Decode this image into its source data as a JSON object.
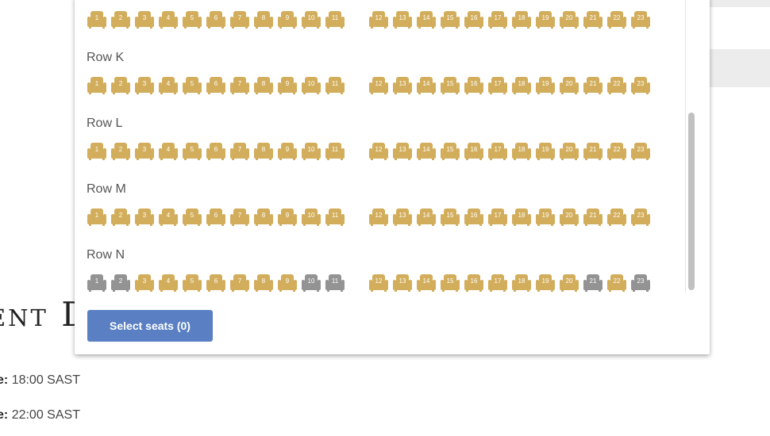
{
  "background": {
    "heading": "ent D",
    "start_time_label": "e:",
    "start_time_value": "18:00 SAST",
    "end_time_label": "e:",
    "end_time_value": "22:00 SAST"
  },
  "colors": {
    "available": "#d2ad5b",
    "unavailable": "#939393",
    "button": "#5a80c3"
  },
  "seating": {
    "rows": [
      {
        "label": "",
        "label_hidden": true,
        "seats": [
          {
            "n": "1",
            "s": "a"
          },
          {
            "n": "2",
            "s": "a"
          },
          {
            "n": "3",
            "s": "a"
          },
          {
            "n": "4",
            "s": "a"
          },
          {
            "n": "5",
            "s": "a"
          },
          {
            "n": "6",
            "s": "a"
          },
          {
            "n": "7",
            "s": "a"
          },
          {
            "n": "8",
            "s": "a"
          },
          {
            "n": "9",
            "s": "a"
          },
          {
            "n": "10",
            "s": "a"
          },
          {
            "n": "11",
            "s": "a"
          },
          {
            "n": "12",
            "s": "a"
          },
          {
            "n": "13",
            "s": "a"
          },
          {
            "n": "14",
            "s": "a"
          },
          {
            "n": "15",
            "s": "a"
          },
          {
            "n": "16",
            "s": "a"
          },
          {
            "n": "17",
            "s": "a"
          },
          {
            "n": "18",
            "s": "a"
          },
          {
            "n": "19",
            "s": "a"
          },
          {
            "n": "20",
            "s": "a"
          },
          {
            "n": "21",
            "s": "a"
          },
          {
            "n": "22",
            "s": "a"
          },
          {
            "n": "23",
            "s": "a"
          }
        ]
      },
      {
        "label": "Row K",
        "seats": [
          {
            "n": "1",
            "s": "a"
          },
          {
            "n": "2",
            "s": "a"
          },
          {
            "n": "3",
            "s": "a"
          },
          {
            "n": "4",
            "s": "a"
          },
          {
            "n": "5",
            "s": "a"
          },
          {
            "n": "6",
            "s": "a"
          },
          {
            "n": "7",
            "s": "a"
          },
          {
            "n": "8",
            "s": "a"
          },
          {
            "n": "9",
            "s": "a"
          },
          {
            "n": "10",
            "s": "a"
          },
          {
            "n": "11",
            "s": "a"
          },
          {
            "n": "12",
            "s": "a"
          },
          {
            "n": "13",
            "s": "a"
          },
          {
            "n": "14",
            "s": "a"
          },
          {
            "n": "15",
            "s": "a"
          },
          {
            "n": "16",
            "s": "a"
          },
          {
            "n": "17",
            "s": "a"
          },
          {
            "n": "18",
            "s": "a"
          },
          {
            "n": "19",
            "s": "a"
          },
          {
            "n": "20",
            "s": "a"
          },
          {
            "n": "21",
            "s": "a"
          },
          {
            "n": "22",
            "s": "a"
          },
          {
            "n": "23",
            "s": "a"
          }
        ]
      },
      {
        "label": "Row L",
        "seats": [
          {
            "n": "1",
            "s": "a"
          },
          {
            "n": "2",
            "s": "a"
          },
          {
            "n": "3",
            "s": "a"
          },
          {
            "n": "4",
            "s": "a"
          },
          {
            "n": "5",
            "s": "a"
          },
          {
            "n": "6",
            "s": "a"
          },
          {
            "n": "7",
            "s": "a"
          },
          {
            "n": "8",
            "s": "a"
          },
          {
            "n": "9",
            "s": "a"
          },
          {
            "n": "10",
            "s": "a"
          },
          {
            "n": "11",
            "s": "a"
          },
          {
            "n": "12",
            "s": "a"
          },
          {
            "n": "13",
            "s": "a"
          },
          {
            "n": "14",
            "s": "a"
          },
          {
            "n": "15",
            "s": "a"
          },
          {
            "n": "16",
            "s": "a"
          },
          {
            "n": "17",
            "s": "a"
          },
          {
            "n": "18",
            "s": "a"
          },
          {
            "n": "19",
            "s": "a"
          },
          {
            "n": "20",
            "s": "a"
          },
          {
            "n": "21",
            "s": "a"
          },
          {
            "n": "22",
            "s": "a"
          },
          {
            "n": "23",
            "s": "a"
          }
        ]
      },
      {
        "label": "Row M",
        "seats": [
          {
            "n": "1",
            "s": "a"
          },
          {
            "n": "2",
            "s": "a"
          },
          {
            "n": "3",
            "s": "a"
          },
          {
            "n": "4",
            "s": "a"
          },
          {
            "n": "5",
            "s": "a"
          },
          {
            "n": "6",
            "s": "a"
          },
          {
            "n": "7",
            "s": "a"
          },
          {
            "n": "8",
            "s": "a"
          },
          {
            "n": "9",
            "s": "a"
          },
          {
            "n": "10",
            "s": "a"
          },
          {
            "n": "11",
            "s": "a"
          },
          {
            "n": "12",
            "s": "a"
          },
          {
            "n": "13",
            "s": "a"
          },
          {
            "n": "14",
            "s": "a"
          },
          {
            "n": "15",
            "s": "a"
          },
          {
            "n": "16",
            "s": "a"
          },
          {
            "n": "17",
            "s": "a"
          },
          {
            "n": "18",
            "s": "a"
          },
          {
            "n": "19",
            "s": "a"
          },
          {
            "n": "20",
            "s": "a"
          },
          {
            "n": "21",
            "s": "a"
          },
          {
            "n": "22",
            "s": "a"
          },
          {
            "n": "23",
            "s": "a"
          }
        ]
      },
      {
        "label": "Row N",
        "seats": [
          {
            "n": "1",
            "s": "u"
          },
          {
            "n": "2",
            "s": "u"
          },
          {
            "n": "3",
            "s": "a"
          },
          {
            "n": "4",
            "s": "a"
          },
          {
            "n": "5",
            "s": "a"
          },
          {
            "n": "6",
            "s": "a"
          },
          {
            "n": "7",
            "s": "a"
          },
          {
            "n": "8",
            "s": "a"
          },
          {
            "n": "9",
            "s": "a"
          },
          {
            "n": "10",
            "s": "u"
          },
          {
            "n": "11",
            "s": "u"
          },
          {
            "n": "12",
            "s": "a"
          },
          {
            "n": "13",
            "s": "a"
          },
          {
            "n": "14",
            "s": "a"
          },
          {
            "n": "15",
            "s": "a"
          },
          {
            "n": "16",
            "s": "a"
          },
          {
            "n": "17",
            "s": "a"
          },
          {
            "n": "18",
            "s": "a"
          },
          {
            "n": "19",
            "s": "a"
          },
          {
            "n": "20",
            "s": "a"
          },
          {
            "n": "21",
            "s": "u"
          },
          {
            "n": "22",
            "s": "a"
          },
          {
            "n": "23",
            "s": "u"
          }
        ]
      }
    ]
  },
  "actions": {
    "select_seats_label": "Select seats (0)"
  }
}
